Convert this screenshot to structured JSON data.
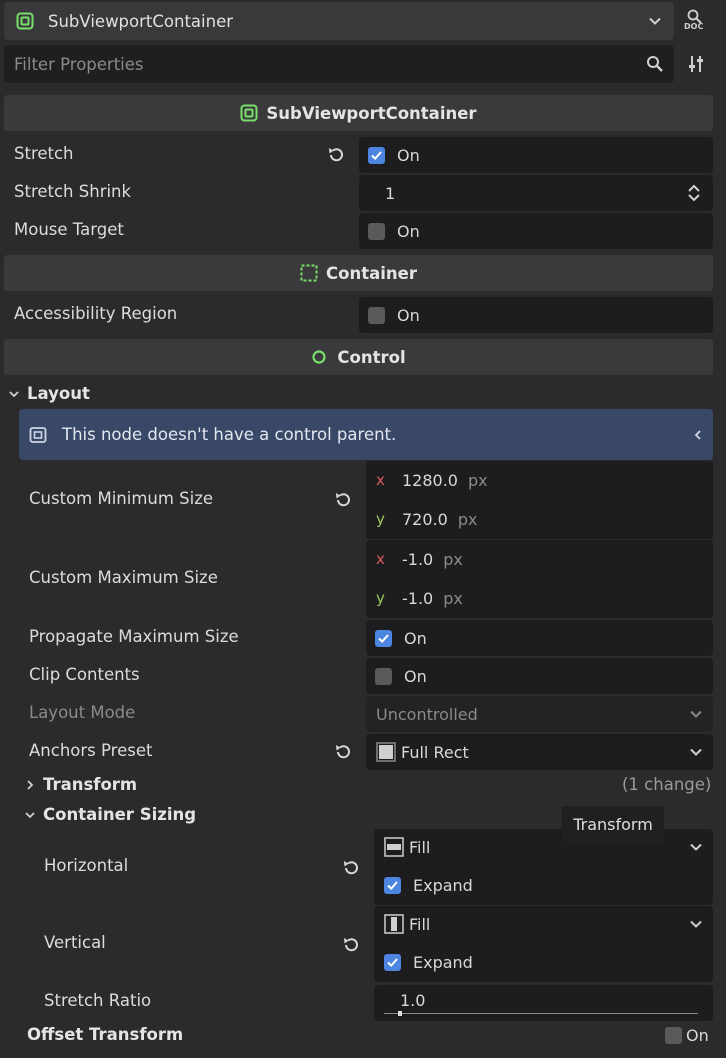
{
  "header": {
    "node_type": "SubViewportContainer",
    "doc_icon_label": "DOC",
    "filter_placeholder": "Filter Properties"
  },
  "sections": {
    "subviewport": "SubViewportContainer",
    "container": "Container",
    "control": "Control"
  },
  "props": {
    "stretch": {
      "label": "Stretch",
      "value": "On",
      "checked": true
    },
    "stretch_shrink": {
      "label": "Stretch Shrink",
      "value": "1"
    },
    "mouse_target": {
      "label": "Mouse Target",
      "value": "On",
      "checked": false
    },
    "accessibility_region": {
      "label": "Accessibility Region",
      "value": "On",
      "checked": false
    }
  },
  "layout": {
    "group_label": "Layout",
    "warning": "This node doesn't have a control parent.",
    "custom_min_size": {
      "label": "Custom Minimum Size",
      "x_axis": "x",
      "y_axis": "y",
      "x": "1280.0",
      "y": "720.0",
      "unit": "px"
    },
    "custom_max_size": {
      "label": "Custom Maximum Size",
      "x_axis": "x",
      "y_axis": "y",
      "x": "-1.0",
      "y": "-1.0",
      "unit": "px"
    },
    "propagate_max": {
      "label": "Propagate Maximum Size",
      "value": "On",
      "checked": true
    },
    "clip_contents": {
      "label": "Clip Contents",
      "value": "On",
      "checked": false
    },
    "layout_mode": {
      "label": "Layout Mode",
      "value": "Uncontrolled"
    },
    "anchors_preset": {
      "label": "Anchors Preset",
      "value": "Full Rect"
    }
  },
  "transform": {
    "label": "Transform",
    "changes": "(1 change)",
    "tooltip": "Transform"
  },
  "container_sizing": {
    "label": "Container Sizing",
    "horizontal": {
      "label": "Horizontal",
      "mode": "Fill",
      "expand": "Expand",
      "expand_checked": true
    },
    "vertical": {
      "label": "Vertical",
      "mode": "Fill",
      "expand": "Expand",
      "expand_checked": true
    },
    "stretch_ratio": {
      "label": "Stretch Ratio",
      "value": "1.0"
    }
  },
  "offset_transform": {
    "label": "Offset Transform",
    "value": "On",
    "checked": false
  },
  "colors": {
    "accent": "#4d86e0",
    "node_green": "#78e06a",
    "axis_x": "#d95b5b",
    "axis_y": "#9bc95a",
    "warning_bg": "#3a4868"
  }
}
